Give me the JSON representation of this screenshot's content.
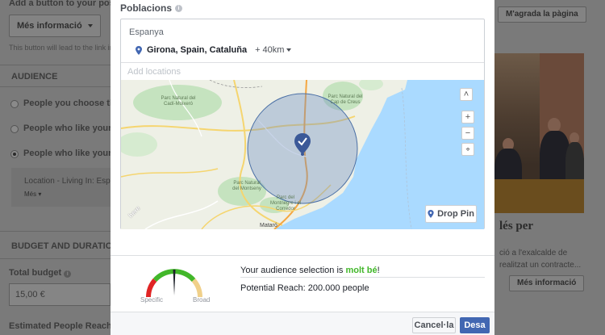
{
  "background_left": {
    "add_button_heading": "Add a button to your post",
    "cta_dropdown": "Més informació",
    "cta_helper": "This button will lead to the link in y",
    "audience_heading": "AUDIENCE",
    "options": [
      {
        "label": "People you choose thro",
        "selected": false
      },
      {
        "label": "People who like your Pa",
        "selected": false
      },
      {
        "label": "People who like your Pa",
        "selected": true
      }
    ],
    "location_summary": "Location - Living In: Espa",
    "more_link": "Més",
    "budget_heading": "BUDGET AND DURATION",
    "total_budget_label": "Total budget",
    "total_budget_value": "15,00 €",
    "estimated_label": "Estimated People Reached"
  },
  "background_right": {
    "like_page_button": "M'agrada la pàgina",
    "headline_fragment": "lés per",
    "body_line1": "ció a l'exalcalde de",
    "body_line2": "realitzat un contracte...",
    "more_info_button": "Més informació"
  },
  "modal": {
    "section_label": "Poblacions",
    "country": "Espanya",
    "location": {
      "name": "Girona, Spain, Cataluña",
      "radius": "+ 40km"
    },
    "add_locations_placeholder": "Add locations",
    "map": {
      "drop_pin_label": "Drop Pin",
      "zoom_in": "+",
      "zoom_out": "−",
      "collapse": "˄",
      "labels": {
        "park1": "Parc Natural del Cadí-Moixeró",
        "park2": "Parc Natural del Cap de Creus",
        "park3": "Parc Natural del Montseny",
        "park4": "Parc del Montnegre i el Corredor",
        "city": "Mataró",
        "brand": "here"
      }
    },
    "gauge": {
      "left_label": "Specific",
      "right_label": "Broad"
    },
    "selection_prefix": "Your audience selection is ",
    "selection_status": "molt bé",
    "selection_suffix": "!",
    "potential_reach": "Potential Reach: 200.000 people",
    "cancel_button": "Cancel·la",
    "save_button": "Desa"
  },
  "colors": {
    "accent": "#4267b2",
    "good": "#42b72a",
    "radius_fill": "#6f8fc4",
    "water": "#aadaff"
  }
}
